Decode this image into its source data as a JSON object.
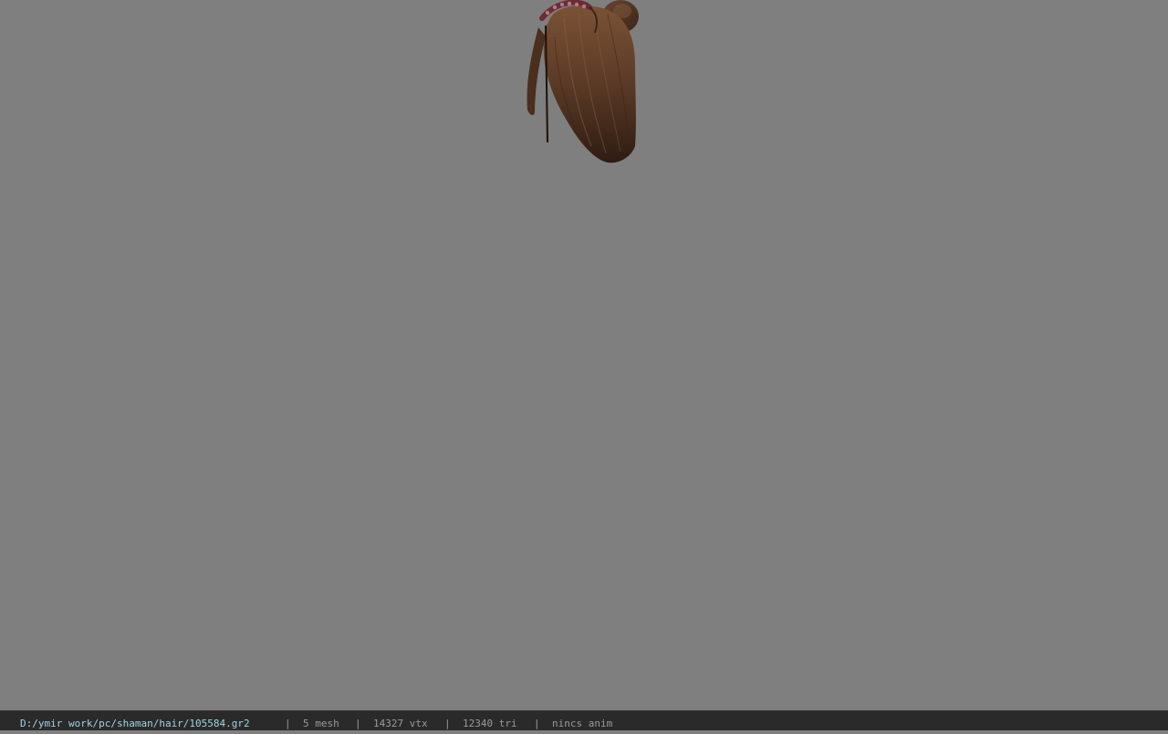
{
  "viewport": {
    "background_color": "#7f7f7f",
    "model": {
      "icon": "hair-model",
      "hair_color": "#5a3a26"
    }
  },
  "statusbar": {
    "path": "D:/ymir work/pc/shaman/hair/105584.gr2",
    "separator": "|",
    "mesh": "5 mesh",
    "vtx": "14327 vtx",
    "tri": "12340 tri",
    "anim": "nincs anim",
    "path_color": "#9fd3e6",
    "text_color": "#9a9a9a"
  }
}
